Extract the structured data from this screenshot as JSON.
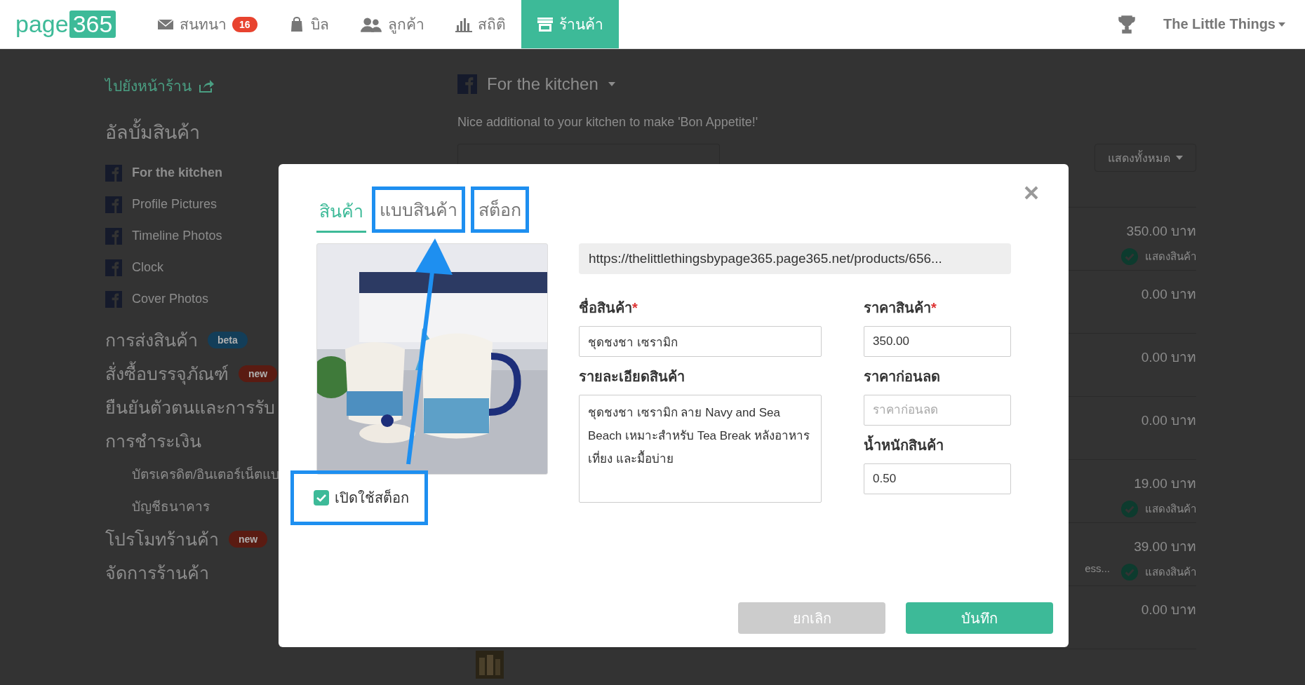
{
  "topbar": {
    "logo": {
      "text": "page",
      "highlight": "365"
    },
    "nav": [
      {
        "label": "สนทนา",
        "badge": "16",
        "selected": false
      },
      {
        "label": "บิล",
        "selected": false
      },
      {
        "label": "ลูกค้า",
        "selected": false
      },
      {
        "label": "สถิติ",
        "selected": false
      },
      {
        "label": "ร้านค้า",
        "selected": true
      }
    ],
    "account": "The Little Things"
  },
  "sidebar": {
    "store_link": "ไปยังหน้าร้าน",
    "albums_title": "อัลบั้มสินค้า",
    "albums": [
      {
        "label": "For the kitchen",
        "selected": true
      },
      {
        "label": "Profile Pictures",
        "selected": false
      },
      {
        "label": "Timeline Photos",
        "selected": false
      },
      {
        "label": "Clock",
        "selected": false
      },
      {
        "label": "Cover Photos",
        "selected": false
      }
    ],
    "sections": [
      {
        "label": "การส่งสินค้า",
        "badge": {
          "text": "beta",
          "color": "#133e59"
        }
      },
      {
        "label": "สั่งซื้อบรรจุภัณฑ์",
        "badge": {
          "text": "new",
          "color": "#5a1b12"
        }
      },
      {
        "label": "ยืนยันตัวตนและการรับ"
      },
      {
        "label": "การชำระเงิน",
        "children": [
          {
            "label": "บัตรเครดิต/อินเตอร์เน็ตแบ"
          },
          {
            "label": "บัญชีธนาคาร"
          }
        ]
      },
      {
        "label": "โปรโมทร้านค้า",
        "badge": {
          "text": "new",
          "color": "#5a1b12"
        }
      },
      {
        "label": "จัดการร้านค้า"
      }
    ]
  },
  "album": {
    "title": "For the kitchen",
    "description": "Nice additional to your kitchen to make 'Bon Appetite!'",
    "filter": "แสดงทั้งหมด",
    "products": [
      {
        "price": "350.00 บาท",
        "visible_label": "แสดงสินค้า"
      },
      {
        "price": "0.00 บาท"
      },
      {
        "price": "0.00 บาท"
      },
      {
        "price": "0.00 บาท"
      },
      {
        "price": "19.00 บาท",
        "visible_label": "แสดงสินค้า"
      },
      {
        "price": "39.00 บาท",
        "visible_label": "แสดงสินค้า",
        "name": "ess..."
      },
      {
        "price": "0.00 บาท"
      }
    ]
  },
  "dialog": {
    "tabs": [
      {
        "label": "สินค้า",
        "selected": true,
        "highlighted": false
      },
      {
        "label": "แบบสินค้า",
        "selected": false,
        "highlighted": true
      },
      {
        "label": "สต็อก",
        "selected": false,
        "highlighted": true
      }
    ],
    "stock_toggle": {
      "label": "เปิดใช้สต็อก",
      "checked": true,
      "highlighted": true
    },
    "url": "https://thelittlethingsbypage365.page365.net/products/656...",
    "fields": {
      "name": {
        "label": "ชื่อสินค้า",
        "required_mark": "*",
        "value": "ชุดชงชา เซรามิก"
      },
      "price": {
        "label": "ราคาสินค้า",
        "required_mark": "*",
        "value": "350.00"
      },
      "description": {
        "label": "รายละเอียดสินค้า",
        "value": "ชุดชงชา เซรามิก ลาย Navy and Sea Beach เหมาะสำหรับ Tea Break หลังอาหารเที่ยง และมื้อบ่าย"
      },
      "compare_price": {
        "label": "ราคาก่อนลด",
        "placeholder": "ราคาก่อนลด"
      },
      "weight": {
        "label": "น้ำหนักสินค้า",
        "value": "0.50"
      }
    },
    "buttons": [
      {
        "label": "ยกเลิก",
        "kind": "secondary"
      },
      {
        "label": "บันทึก",
        "kind": "primary"
      }
    ]
  }
}
